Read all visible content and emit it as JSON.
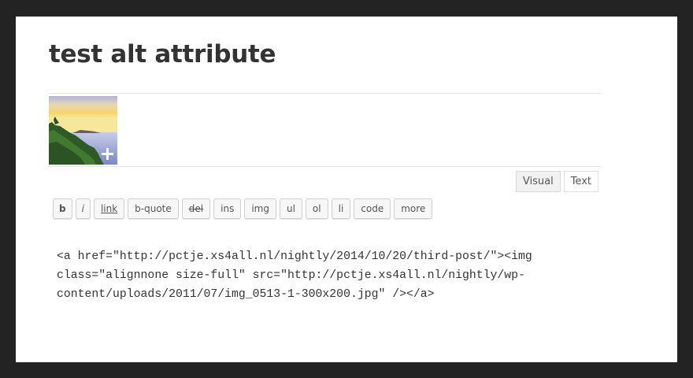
{
  "post": {
    "title": "test alt attribute"
  },
  "thumbnail": {
    "icon": "plus-icon"
  },
  "mode_tabs": [
    {
      "label": "Visual",
      "active": true
    },
    {
      "label": "Text",
      "active": false
    }
  ],
  "quicktags": [
    {
      "label": "b"
    },
    {
      "label": "i"
    },
    {
      "label": "link"
    },
    {
      "label": "b-quote"
    },
    {
      "label": "del"
    },
    {
      "label": "ins"
    },
    {
      "label": "img"
    },
    {
      "label": "ul"
    },
    {
      "label": "ol"
    },
    {
      "label": "li"
    },
    {
      "label": "code"
    },
    {
      "label": "more"
    }
  ],
  "editor": {
    "lines": [
      "<a href=\"http://pctje.xs4all.nl/nightly/2014/10/20/third-post/\"><img",
      "class=\"alignnone size-full\" src=\"http://pctje.xs4all.nl/nightly/wp-",
      "content/uploads/2011/07/img_0513-1-300x200.jpg\" /></a>"
    ]
  },
  "colors": {
    "frame": "#232323",
    "panel": "#ffffff",
    "title": "#333333"
  }
}
